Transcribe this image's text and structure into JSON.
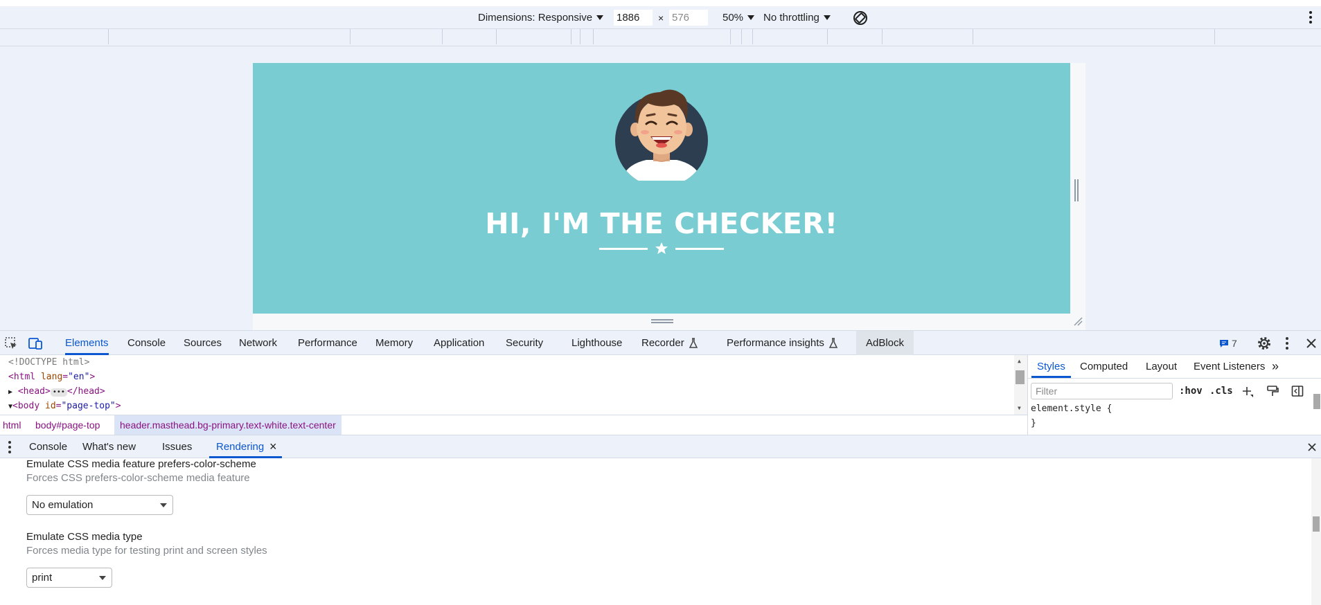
{
  "device_toolbar": {
    "dimensions_label": "Dimensions: Responsive",
    "width_value": "1886",
    "times": "×",
    "height_value": "576",
    "zoom": "50%",
    "throttling": "No throttling"
  },
  "page": {
    "title": "HI, I'M THE CHECKER!",
    "background_color": "#79ccd2"
  },
  "devtools_tabs": [
    "Elements",
    "Console",
    "Sources",
    "Network",
    "Performance",
    "Memory",
    "Application",
    "Security",
    "Lighthouse",
    "Recorder",
    "Performance insights",
    "AdBlock"
  ],
  "issues_count": "7",
  "elements": {
    "doctype": "<!DOCTYPE html>",
    "html_open": "<html lang=\"en\">",
    "head": "<head>",
    "head_close": "</head>",
    "body_open": "<body id=\"page-top\">"
  },
  "breadcrumbs": [
    "html",
    "body#page-top",
    "header.masthead.bg-primary.text-white.text-center"
  ],
  "styles": {
    "tabs": [
      "Styles",
      "Computed",
      "Layout",
      "Event Listeners"
    ],
    "more": "»",
    "filter_placeholder": "Filter",
    "hov": ":hov",
    "cls": ".cls",
    "rule_open": "element.style {",
    "rule_close": "}"
  },
  "drawer": {
    "tabs": [
      "Console",
      "What's new",
      "Issues",
      "Rendering"
    ],
    "close": "×",
    "sections": [
      {
        "title": "Emulate CSS media feature prefers-color-scheme",
        "description": "Forces CSS prefers-color-scheme media feature",
        "value": "No emulation"
      },
      {
        "title": "Emulate CSS media type",
        "description": "Forces media type for testing print and screen styles",
        "value": "print"
      }
    ]
  },
  "colors": {
    "accent": "#0b57d0",
    "toolbar_bg": "#edf2fa"
  }
}
